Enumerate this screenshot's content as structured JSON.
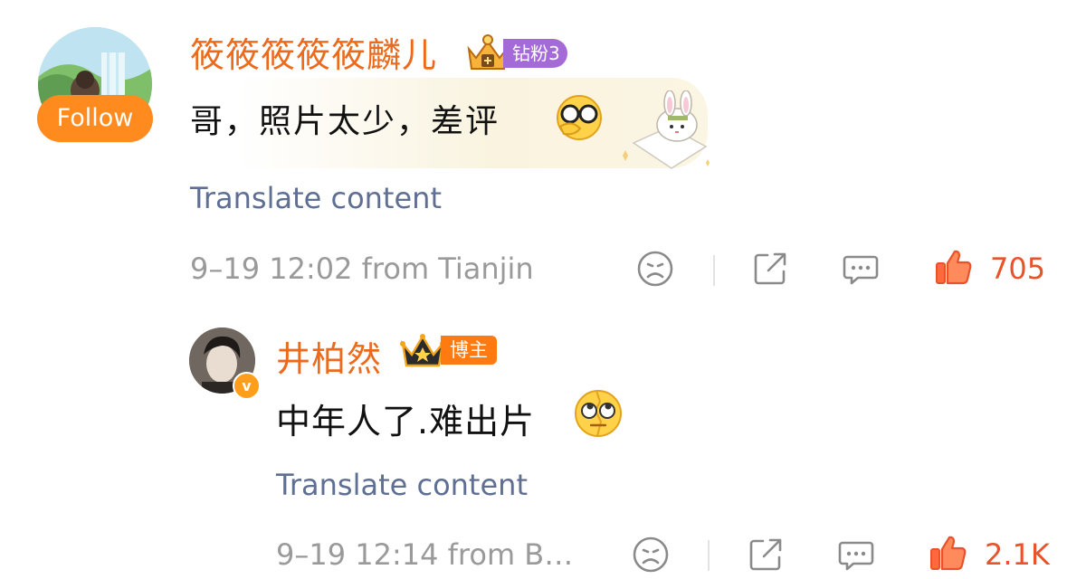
{
  "colors": {
    "username": "#eb6a1c",
    "translate": "#5f6e93",
    "meta": "#9a9a9a",
    "like": "#e8532b",
    "follow": "#ff8a1e",
    "fan_badge": "#a46bd8",
    "blogger_badge": "#ff7a10"
  },
  "comments": [
    {
      "username": "筱筱筱筱筱麟儿",
      "follow_label": "Follow",
      "fan_badge": "钻粉3",
      "text": "哥，照片太少，差评",
      "emoji": "glasses-face-icon",
      "translate": "Translate content",
      "date": "9–19 12:02",
      "location": "from Tianjin",
      "likes": "705"
    },
    {
      "username": "井柏然",
      "verified_mark": "v",
      "role_badge": "博主",
      "text": "中年人了.难出片",
      "emoji": "eye-roll-face-icon",
      "translate": "Translate content",
      "date": "9–19 12:14",
      "location": "from B…",
      "likes": "2.1K"
    }
  ]
}
